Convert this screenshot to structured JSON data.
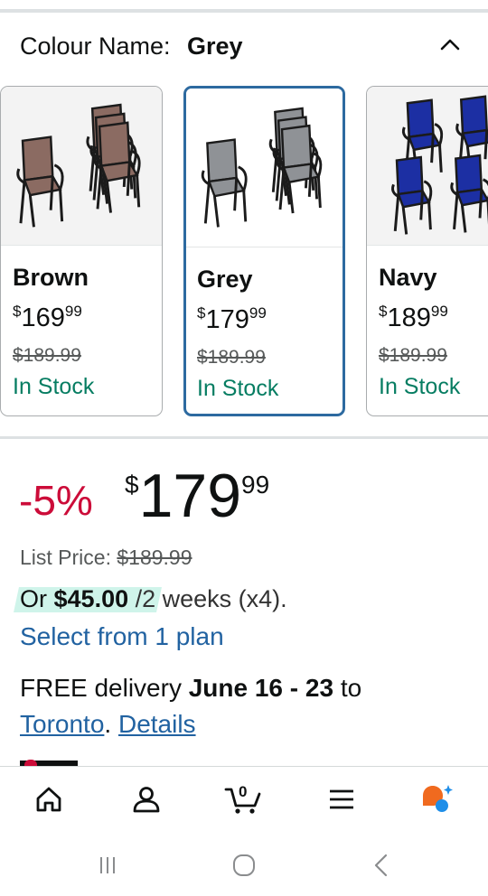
{
  "colour": {
    "label": "Colour Name:",
    "value": "Grey"
  },
  "variants": [
    {
      "name": "Brown",
      "currency": "$",
      "price_whole": "169",
      "price_fraction": "99",
      "was": "$189.99",
      "stock": "In Stock",
      "selected": false,
      "chair_color": "#8b6b62"
    },
    {
      "name": "Grey",
      "currency": "$",
      "price_whole": "179",
      "price_fraction": "99",
      "was": "$189.99",
      "stock": "In Stock",
      "selected": true,
      "chair_color": "#8f9296"
    },
    {
      "name": "Navy",
      "currency": "$",
      "price_whole": "189",
      "price_fraction": "99",
      "was": "$189.99",
      "stock": "In Stock",
      "selected": false,
      "chair_color": "#1c2fa3"
    }
  ],
  "price": {
    "discount": "-5%",
    "currency": "$",
    "whole": "179",
    "fraction": "99"
  },
  "list_price": {
    "label": "List Price:",
    "value": "$189.99"
  },
  "installment": {
    "prefix": "Or",
    "amount": "$45.00",
    "suffix": "/2 weeks (x4)."
  },
  "plan_link": "Select from 1 plan",
  "delivery": {
    "prefix": "FREE delivery",
    "dates": "June 16 - 23",
    "to": "to",
    "city": "Toronto",
    "period": ".",
    "details": "Details"
  },
  "tabbar": {
    "cart_count": "0",
    "items": [
      "home-icon",
      "account-icon",
      "cart-icon",
      "menu-icon",
      "rufus-icon"
    ]
  },
  "system_nav": [
    "recents-icon",
    "home-circle-icon",
    "back-icon"
  ],
  "colors": {
    "accent_link": "#2162a1",
    "selected_border": "#2d6aa0",
    "discount_red": "#cc0c39",
    "stock_green": "#067d62",
    "installment_highlight": "#cff4ea"
  }
}
